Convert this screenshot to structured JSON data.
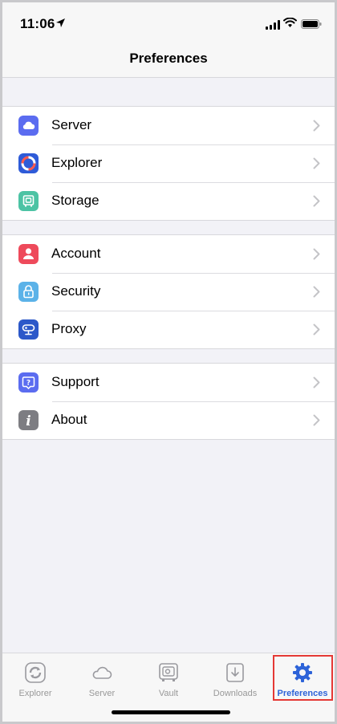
{
  "status_bar": {
    "time": "11:06"
  },
  "header": {
    "title": "Preferences"
  },
  "groups": [
    {
      "items": [
        {
          "label": "Server",
          "icon": "cloud-icon",
          "color": "#5b6cf0"
        },
        {
          "label": "Explorer",
          "icon": "explorer-icon",
          "color": "#2e5bd8"
        },
        {
          "label": "Storage",
          "icon": "storage-icon",
          "color": "#4cc3a4"
        }
      ]
    },
    {
      "items": [
        {
          "label": "Account",
          "icon": "person-icon",
          "color": "#ee4a5b"
        },
        {
          "label": "Security",
          "icon": "lock-icon",
          "color": "#5bb2e8"
        },
        {
          "label": "Proxy",
          "icon": "proxy-icon",
          "color": "#2c58c9"
        }
      ]
    },
    {
      "items": [
        {
          "label": "Support",
          "icon": "question-icon",
          "color": "#5b6cf0"
        },
        {
          "label": "About",
          "icon": "info-icon",
          "color": "#7d7d82"
        }
      ]
    }
  ],
  "tabbar": {
    "tabs": [
      {
        "label": "Explorer",
        "icon": "refresh-icon",
        "active": false
      },
      {
        "label": "Server",
        "icon": "cloud-icon",
        "active": false
      },
      {
        "label": "Vault",
        "icon": "vault-icon",
        "active": false
      },
      {
        "label": "Downloads",
        "icon": "download-icon",
        "active": false
      },
      {
        "label": "Preferences",
        "icon": "gear-icon",
        "active": true
      }
    ]
  },
  "colors": {
    "accent": "#2d63d8",
    "highlight": "#e53935"
  }
}
